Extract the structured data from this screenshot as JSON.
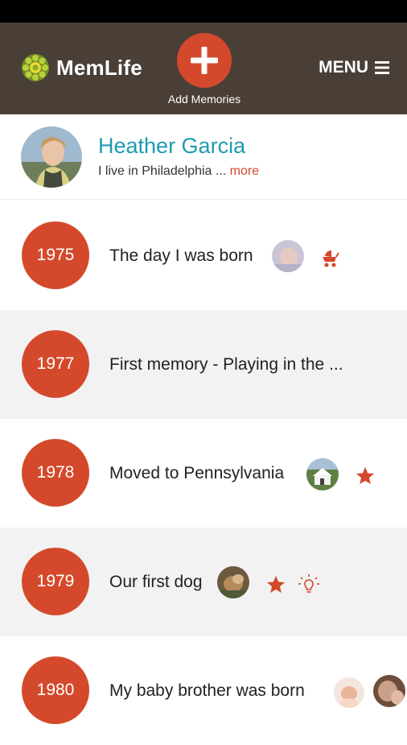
{
  "app": {
    "name": "MemLife",
    "add_label": "Add Memories",
    "menu_label": "MENU"
  },
  "profile": {
    "name": "Heather Garcia",
    "bio": "I live in Philadelphia ...",
    "more_label": "more"
  },
  "timeline": [
    {
      "year": "1975",
      "title": "The day I was born",
      "icons": [
        "baby-photo-thumbnail",
        "stroller-icon"
      ]
    },
    {
      "year": "1977",
      "title": "First memory - Playing in the ...",
      "icons": []
    },
    {
      "year": "1978",
      "title": "Moved to Pennsylvania",
      "icons": [
        "house-photo-thumbnail",
        "star-icon"
      ]
    },
    {
      "year": "1979",
      "title": "Our first dog",
      "icons": [
        "dog-photo-thumbnail",
        "star-icon",
        "lightbulb-icon"
      ]
    },
    {
      "year": "1980",
      "title": "My baby brother was born",
      "icons": [
        "baby-brother-photo-thumbnail",
        "family-photo-thumbnail"
      ]
    }
  ],
  "colors": {
    "header": "#4a3f37",
    "accent": "#d4492b",
    "name": "#1e9bb0",
    "alt_row": "#f2f2f2"
  }
}
